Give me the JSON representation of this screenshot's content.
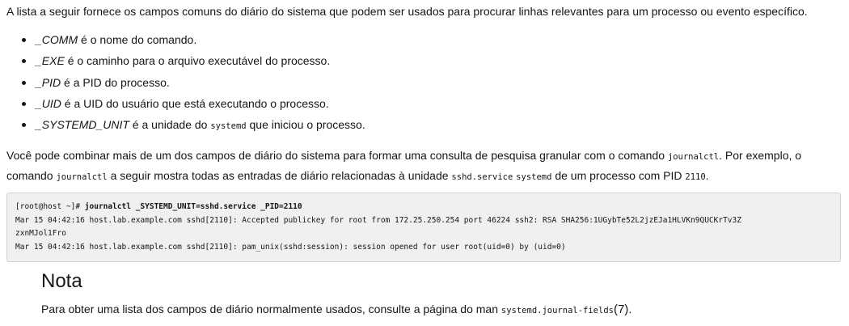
{
  "intro": "A lista a seguir fornece os campos comuns do diário do sistema que podem ser usados para procurar linhas relevantes para um processo ou evento específico.",
  "fields": [
    {
      "name": "_COMM",
      "pre": " é o nome do comando.",
      "code": "",
      "post": ""
    },
    {
      "name": "_EXE",
      "pre": " é o caminho para o arquivo executável do processo.",
      "code": "",
      "post": ""
    },
    {
      "name": "_PID",
      "pre": " é a PID do processo.",
      "code": "",
      "post": ""
    },
    {
      "name": "_UID",
      "pre": " é a UID do usuário que está executando o processo.",
      "code": "",
      "post": ""
    },
    {
      "name": "_SYSTEMD_UNIT",
      "pre": " é a unidade do ",
      "code": "systemd",
      "post": " que iniciou o processo."
    }
  ],
  "combine": {
    "t1": "Você pode combinar mais de um dos campos de diário do sistema para formar uma consulta de pesquisa granular com o comando ",
    "c1": "journalctl",
    "t2": ". Por exemplo, o comando ",
    "c2": "journalctl",
    "t3": " a seguir mostra todas as entradas de diário relacionadas à unidade ",
    "c3": "sshd.service",
    "t4": " ",
    "c4": "systemd",
    "t5": " de um processo com PID ",
    "c5": "2110",
    "t6": "."
  },
  "code": {
    "prompt": "[root@host ~]# ",
    "command": "journalctl _SYSTEMD_UNIT=sshd.service _PID=2110",
    "line1": "Mar 15 04:42:16 host.lab.example.com sshd[2110]: Accepted publickey for root from 172.25.250.254 port 46224 ssh2: RSA SHA256:1UGybTe52L2jzEJa1HLVKn9QUCKrTv3Z",
    "line2": "zxnMJol1Fro",
    "line3": "Mar 15 04:42:16 host.lab.example.com sshd[2110]: pam_unix(sshd:session): session opened for user root(uid=0) by (uid=0)"
  },
  "note": {
    "title": "Nota",
    "text": "Para obter uma lista dos campos de diário normalmente usados, consulte a página do man ",
    "code": "systemd.journal-fields",
    "suffix": "(7)",
    "end": "."
  }
}
